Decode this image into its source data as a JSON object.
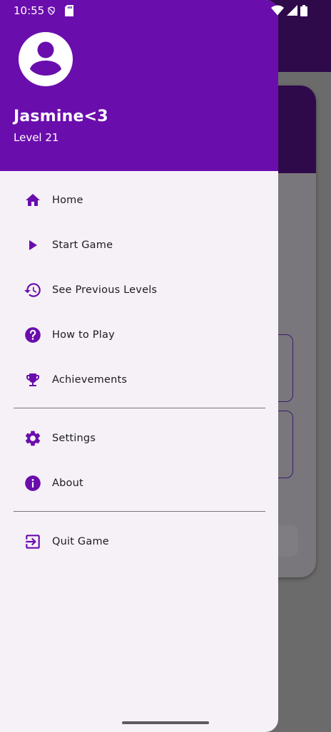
{
  "status_bar": {
    "time": "10:55",
    "icons": [
      "shield-icon",
      "sd-card-icon",
      "wifi-icon",
      "signal-icon",
      "battery-icon"
    ]
  },
  "drawer": {
    "header": {
      "name": "Jasmine<3",
      "level": "Level 21",
      "avatar_icon": "account-circle-icon",
      "background_color": "#6a0dad"
    },
    "groups": [
      [
        {
          "label": "Home",
          "icon": "home-icon"
        },
        {
          "label": "Start Game",
          "icon": "play-icon"
        },
        {
          "label": "See Previous Levels",
          "icon": "history-icon"
        },
        {
          "label": "How to Play",
          "icon": "help-icon"
        },
        {
          "label": "Achievements",
          "icon": "trophy-icon"
        }
      ],
      [
        {
          "label": "Settings",
          "icon": "gear-icon"
        },
        {
          "label": "About",
          "icon": "info-icon"
        }
      ],
      [
        {
          "label": "Quit Game",
          "icon": "exit-icon"
        }
      ]
    ],
    "accent_color": "#6a0dad",
    "surface_color": "#f6f1f7"
  }
}
